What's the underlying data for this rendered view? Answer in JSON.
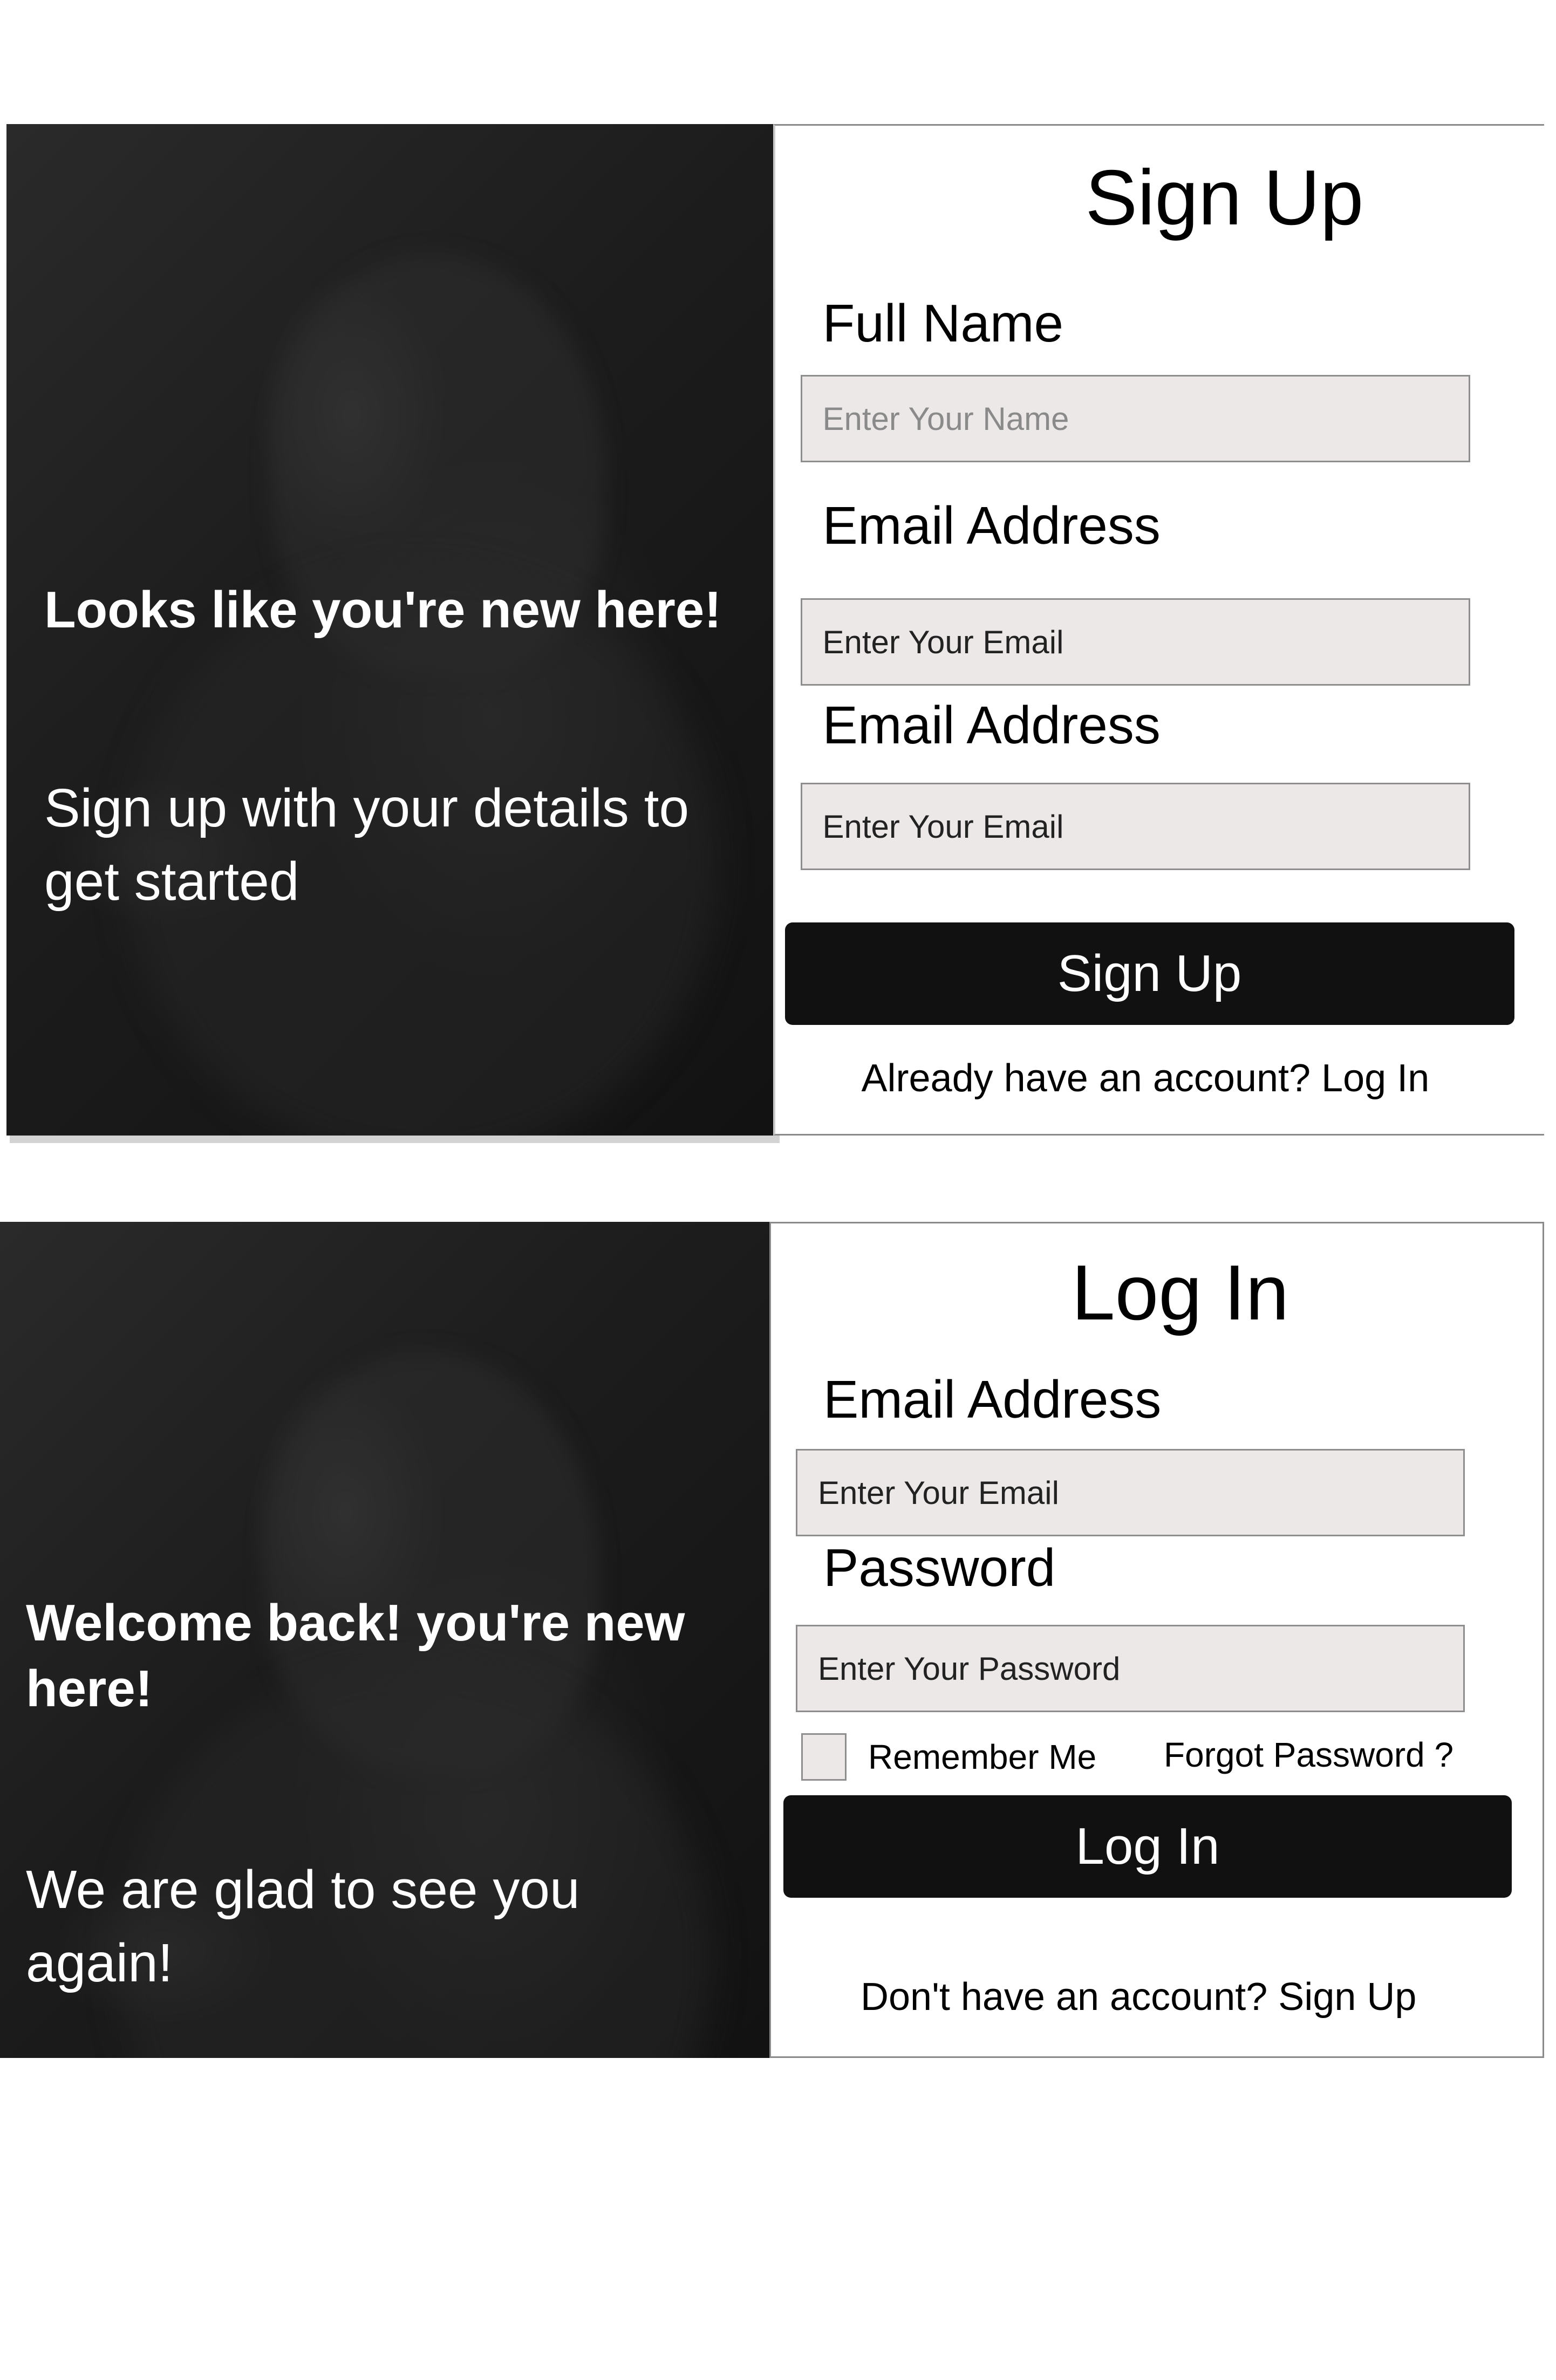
{
  "signup": {
    "hero": {
      "headline": "Looks like you're new here!",
      "subline": "Sign up with your details to get started"
    },
    "title": "Sign Up",
    "full_name": {
      "label": "Full Name",
      "placeholder": "Enter Your Name"
    },
    "email_1": {
      "label": "Email Address",
      "placeholder": "Enter Your Email"
    },
    "email_2": {
      "label": "Email Address",
      "placeholder": "Enter Your Email"
    },
    "submit_label": "Sign Up",
    "footer": {
      "prompt": "Already have an account?",
      "link": "Log In"
    }
  },
  "login": {
    "hero": {
      "headline": "Welcome back! you're new here!",
      "subline": "We are glad to see you again!"
    },
    "title": "Log In",
    "email": {
      "label": "Email Address",
      "placeholder": "Enter Your Email"
    },
    "password": {
      "label": "Password",
      "placeholder": "Enter Your Password"
    },
    "remember_label": "Remember Me",
    "forgot_label": "Forgot Password ?",
    "submit_label": "Log In",
    "footer": {
      "prompt": "Don't have an account?",
      "link": "Sign Up"
    }
  },
  "colors": {
    "button_bg": "#111111",
    "field_bg": "#ece8e8",
    "field_border": "#8e8e8e",
    "hero_text": "#ffffff"
  }
}
